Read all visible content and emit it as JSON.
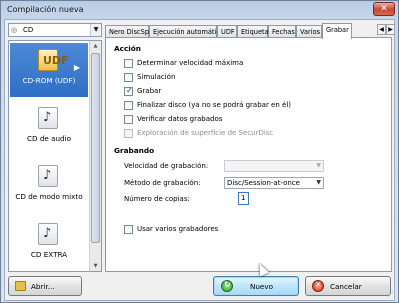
{
  "window": {
    "title": "Compilación nueva",
    "close_label": "✕"
  },
  "format_combo": {
    "value": "CD"
  },
  "project_list": {
    "items": [
      {
        "label": "CD-ROM (UDF)",
        "selected": true
      },
      {
        "label": "CD de audio",
        "selected": false
      },
      {
        "label": "CD de modo mixto",
        "selected": false
      },
      {
        "label": "CD EXTRA",
        "selected": false
      }
    ]
  },
  "tabs": [
    {
      "label": "Nero DiscSpan",
      "active": false
    },
    {
      "label": "Ejecución automática",
      "active": false
    },
    {
      "label": "UDF",
      "active": false
    },
    {
      "label": "Etiqueta",
      "active": false
    },
    {
      "label": "Fechas",
      "active": false
    },
    {
      "label": "Varios",
      "active": false
    },
    {
      "label": "Grabar",
      "active": true
    }
  ],
  "accion": {
    "heading": "Acción",
    "options": [
      {
        "label": "Determinar velocidad máxima",
        "checked": false,
        "enabled": true
      },
      {
        "label": "Simulación",
        "checked": false,
        "enabled": true
      },
      {
        "label": "Grabar",
        "checked": true,
        "enabled": true
      },
      {
        "label": "Finalizar disco (ya no se podrá grabar en él)",
        "checked": false,
        "enabled": true
      },
      {
        "label": "Verificar datos grabados",
        "checked": false,
        "enabled": true
      },
      {
        "label": "Exploración de superficie de SecurDisc",
        "checked": false,
        "enabled": false
      }
    ]
  },
  "grabando": {
    "heading": "Grabando",
    "speed_label": "Velocidad de grabación:",
    "speed_value": "",
    "method_label": "Método de grabación:",
    "method_value": "Disc/Session-at-once",
    "copies_label": "Número de copias:",
    "copies_value": "1",
    "multi_label": "Usar varios grabadores"
  },
  "buttons": {
    "open": "Abrir...",
    "new": "Nuevo",
    "cancel": "Cancelar"
  }
}
